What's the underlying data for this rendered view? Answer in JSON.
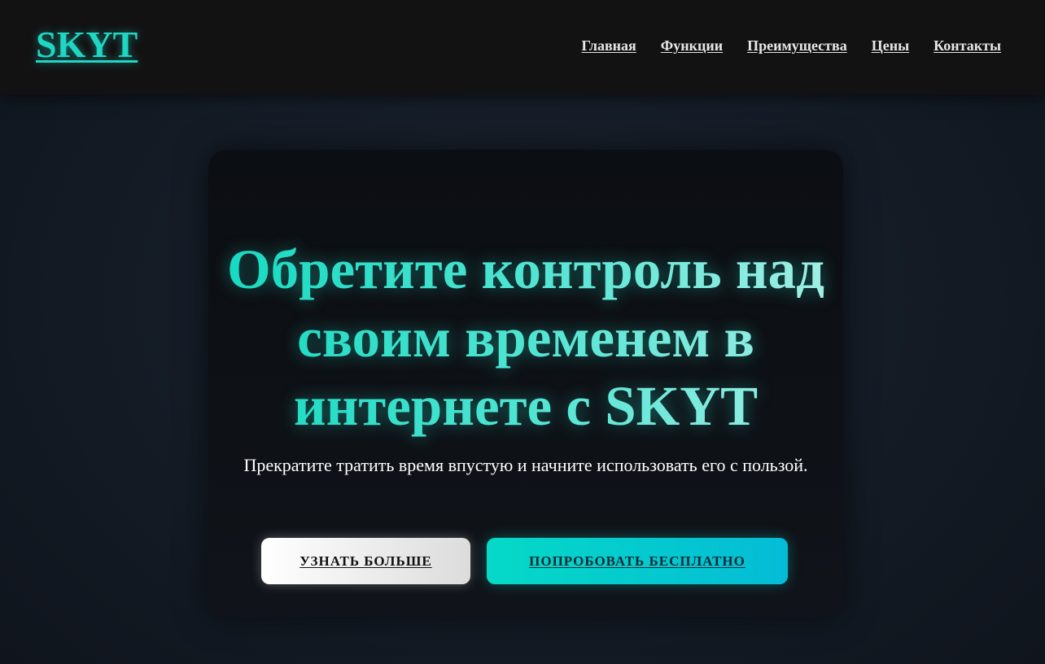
{
  "header": {
    "logo": "SKYT",
    "nav": [
      {
        "label": "Главная"
      },
      {
        "label": "Функции"
      },
      {
        "label": "Преимущества"
      },
      {
        "label": "Цены"
      },
      {
        "label": "Контакты"
      }
    ]
  },
  "hero": {
    "title": "Обретите контроль над своим временем в интернете с SKYT",
    "subtitle": "Прекратите тратить время впустую и начните использовать его с пользой.",
    "buttons": {
      "learn_more": "УЗНАТЬ БОЛЬШЕ",
      "try_free": "ПОПРОБОВАТЬ БЕСПЛАТНО"
    }
  },
  "colors": {
    "accent": "#1fd5c3",
    "navbar_bg": "#121212",
    "page_bg": "#161d27",
    "card_bg": "#0d1116"
  }
}
